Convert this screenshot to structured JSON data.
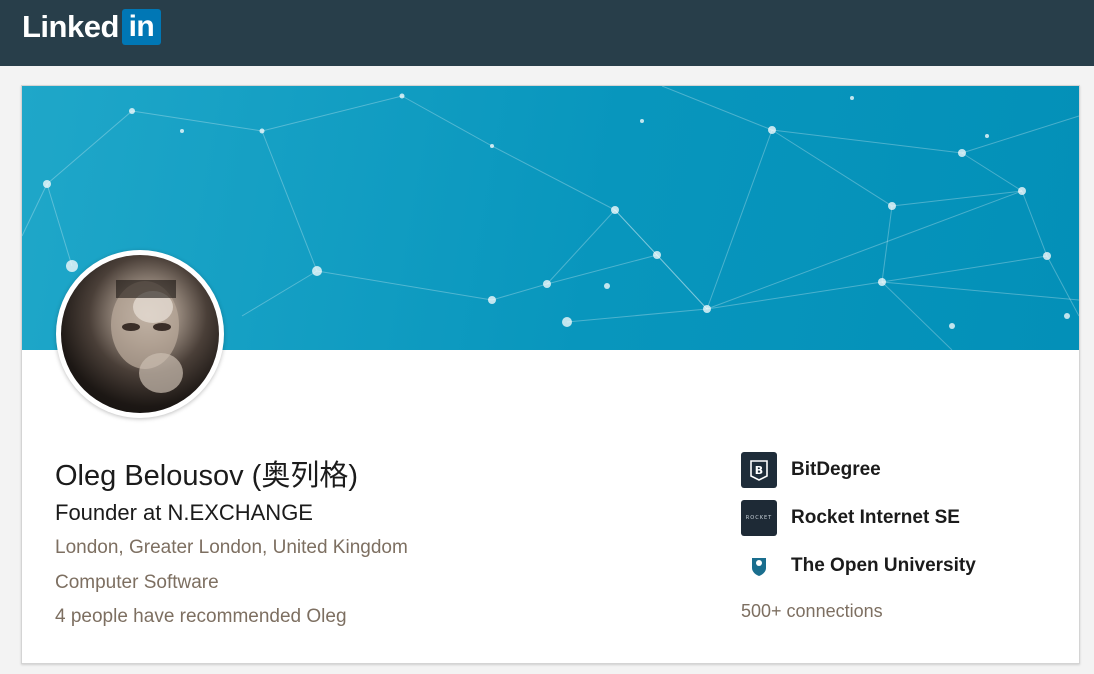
{
  "header": {
    "logo_word": "Linked",
    "logo_box": "in"
  },
  "profile": {
    "name": "Oleg Belousov (奥列格)",
    "headline": "Founder at N.EXCHANGE",
    "location": "London, Greater London, United Kingdom",
    "industry": "Computer Software",
    "recommendations": "4 people have recommended Oleg"
  },
  "sidebar": {
    "companies": [
      {
        "name": "BitDegree",
        "icon": "bitdegree-logo-icon"
      },
      {
        "name": "Rocket Internet SE",
        "icon": "rocket-internet-logo-icon",
        "logo_text": "ROCKET"
      },
      {
        "name": "The Open University",
        "icon": "open-university-logo-icon"
      }
    ],
    "connections": "500+ connections"
  },
  "colors": {
    "topbar": "#283e4a",
    "linkedin_blue": "#0077b5",
    "banner": "#0896bd",
    "meta_text": "#7d6f61"
  }
}
